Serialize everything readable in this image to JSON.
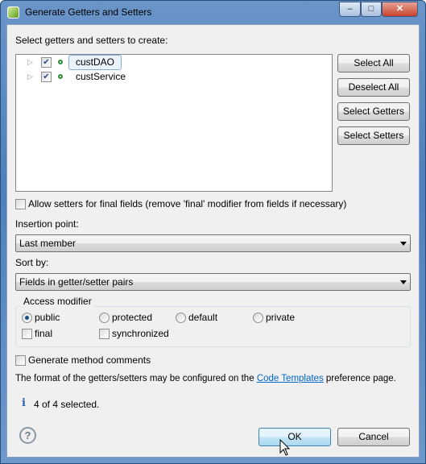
{
  "window": {
    "title": "Generate Getters and Setters",
    "minimize": "‒",
    "maximize": "□",
    "close": "✕"
  },
  "tree": {
    "label": "Select getters and setters to create:",
    "items": [
      {
        "name": "custDAO",
        "checked": true,
        "selected": true
      },
      {
        "name": "custService",
        "checked": true,
        "selected": false
      }
    ]
  },
  "buttons": {
    "select_all": "Select All",
    "deselect_all": "Deselect All",
    "select_getters": "Select Getters",
    "select_setters": "Select Setters",
    "ok": "OK",
    "cancel": "Cancel"
  },
  "allow_setters": {
    "label": "Allow setters for final fields (remove 'final' modifier from fields if necessary)",
    "checked": false
  },
  "insertion": {
    "label": "Insertion point:",
    "value": "Last member"
  },
  "sort": {
    "label": "Sort by:",
    "value": "Fields in getter/setter pairs"
  },
  "access": {
    "legend": "Access modifier",
    "options": [
      "public",
      "protected",
      "default",
      "private"
    ],
    "selected": "public",
    "final": "final",
    "synchronized": "synchronized"
  },
  "comments": {
    "label": "Generate method comments",
    "checked": false
  },
  "format": {
    "before": "The format of the getters/setters may be configured on the ",
    "link": "Code Templates",
    "after": " preference page."
  },
  "status": {
    "text": "4 of 4 selected."
  },
  "colors": {
    "link": "#0066cc",
    "field_icon": "#2e8b3a",
    "title_bar": "#4f7fbd"
  }
}
